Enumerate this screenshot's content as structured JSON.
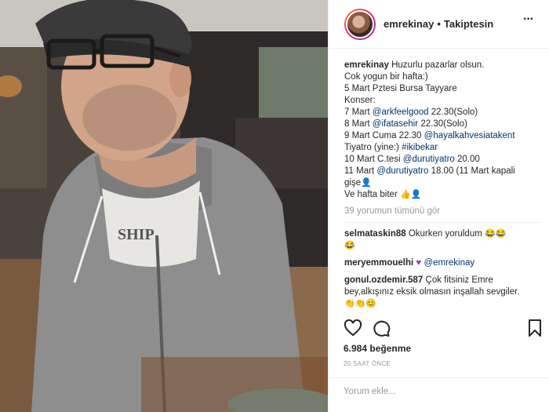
{
  "header": {
    "username": "emrekinay",
    "follow_label": "Takiptesin"
  },
  "caption": {
    "username": "emrekinay",
    "lines": [
      "Huzurlu pazarlar olsun.",
      "Cok yogun bir hafta:)",
      "5 Mart Pztesi Bursa Tayyare",
      "Konser:",
      "7 Mart",
      "@arkfeelgood",
      "22.30(Solo)",
      "8 Mart",
      "@ifatasehir",
      "22.30(Solo)",
      "9 Mart Cuma 22.30",
      "@hayalkahvesiatakent",
      "Tiyatro (yine:)",
      "#ikibekar",
      "10 Mart C.tesi",
      "@durutiyatro",
      "20.00",
      "11 Mart",
      "@durutiyatro",
      "18.00 (11 Mart kapali",
      "gişe",
      "Ve hafta biter"
    ]
  },
  "view_all_comments": "39 yorumun tümünü gör",
  "comments": [
    {
      "username": "selmataskin88",
      "text": "Okurken yoruldum"
    },
    {
      "username": "meryemmouelhi",
      "mention": "@emrekinay"
    },
    {
      "username": "gonul.ozdemir.587",
      "text": "Çok fitsiniz Emre",
      "text2": "bey,alkışınız eksik olmasın inşallah sevgiler."
    }
  ],
  "likes": "6.984 beğenme",
  "timestamp": "20 SAAT ÖNCE",
  "add_comment_placeholder": "Yorum ekle..."
}
